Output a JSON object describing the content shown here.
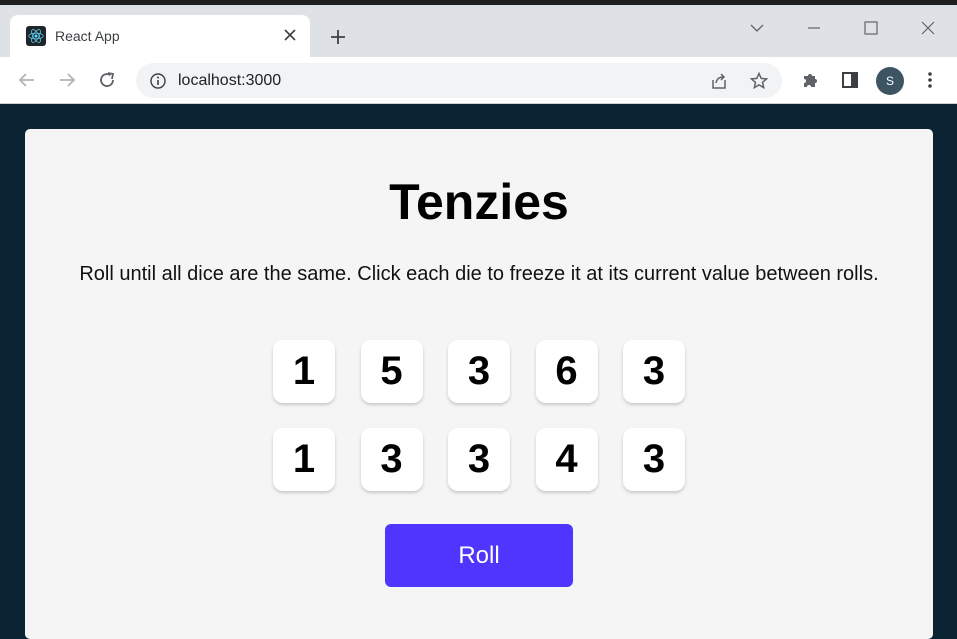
{
  "browser": {
    "tab_title": "React App",
    "url": "localhost:3000",
    "profile_initial": "S"
  },
  "game": {
    "title": "Tenzies",
    "instructions": "Roll until all dice are the same. Click each die to freeze it at its current value between rolls.",
    "dice": [
      "1",
      "5",
      "3",
      "6",
      "3",
      "1",
      "3",
      "3",
      "4",
      "3"
    ],
    "roll_label": "Roll"
  },
  "colors": {
    "page_background": "#0b2434",
    "card_background": "#f5f5f5",
    "roll_button": "#5035ff"
  }
}
